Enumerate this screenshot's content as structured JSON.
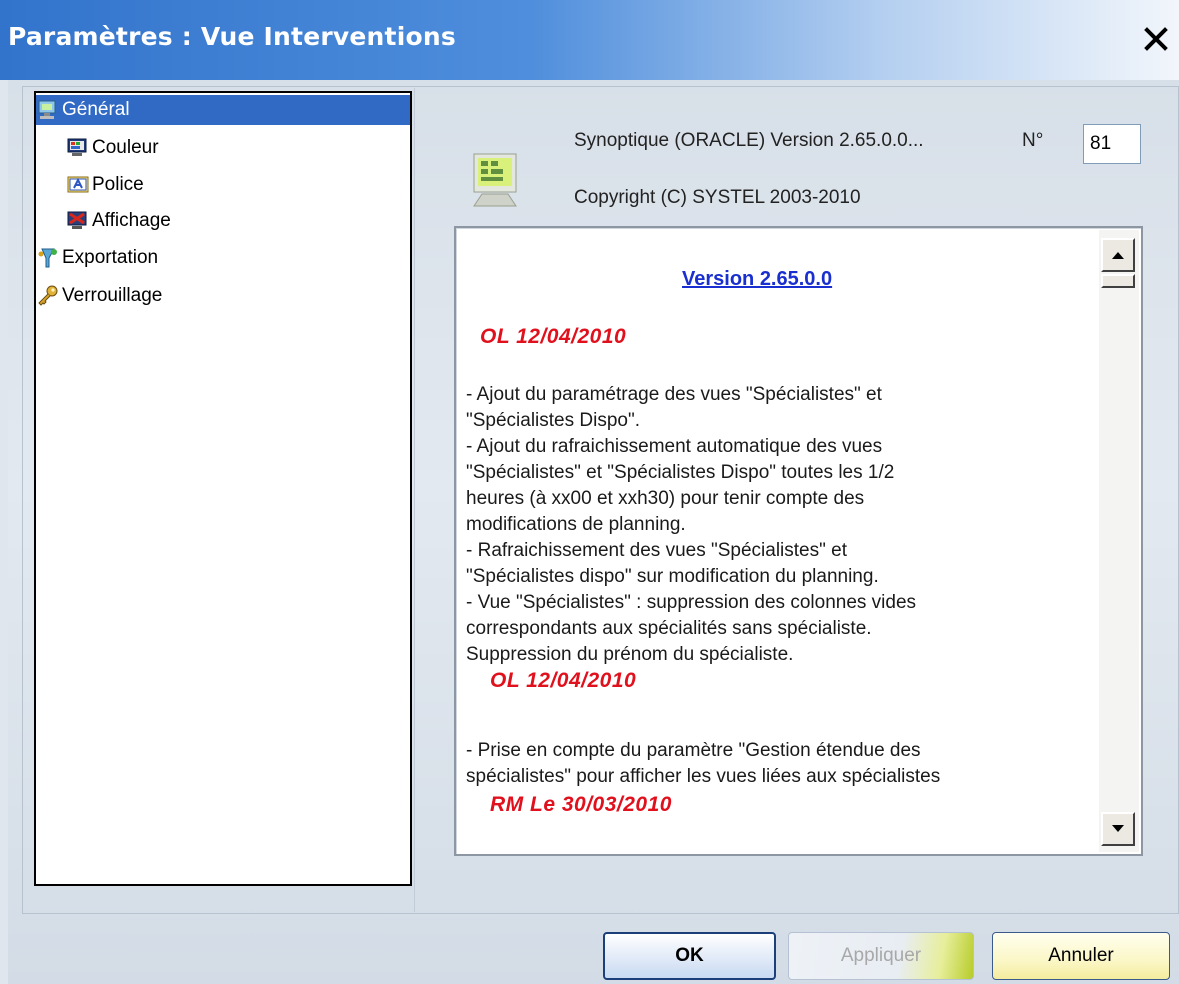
{
  "window": {
    "title": "Paramètres : Vue Interventions",
    "close_glyph": "✕"
  },
  "tree": {
    "items": [
      {
        "label": "Général",
        "icon": "general-settings-icon",
        "selected": true
      },
      {
        "label": "Couleur",
        "icon": "monitor-color-icon"
      },
      {
        "label": "Police",
        "icon": "font-icon"
      },
      {
        "label": "Affichage",
        "icon": "display-icon"
      },
      {
        "label": "Exportation",
        "icon": "export-icon"
      },
      {
        "label": "Verrouillage",
        "icon": "key-icon"
      }
    ]
  },
  "about": {
    "version_line": "Synoptique (ORACLE) Version 2.65.0.0...",
    "number_label": "N°",
    "number_value": "81",
    "copyright": "Copyright (C) SYSTEL 2003-2010"
  },
  "notes": {
    "heading": "Version 2.65.0.0",
    "author1": "OL 12/04/2010",
    "lines1": [
      "- Ajout du paramétrage des vues \"Spécialistes\" et",
      "\"Spécialistes Dispo\".",
      "- Ajout du rafraichissement automatique des vues",
      "\"Spécialistes\" et \"Spécialistes Dispo\" toutes les 1/2",
      "heures (à xx00 et xxh30) pour tenir compte des",
      "modifications de planning.",
      "- Rafraichissement des vues \"Spécialistes\" et",
      "\"Spécialistes dispo\" sur modification du planning.",
      "- Vue \"Spécialistes\" : suppression des colonnes vides",
      "correspondants aux spécialités sans spécialiste.",
      "Suppression du prénom du spécialiste."
    ],
    "author2": "OL 12/04/2010",
    "lines2": [
      "- Prise en compte du paramètre \"Gestion étendue des",
      "spécialistes\" pour afficher les vues liées aux spécialistes"
    ],
    "author3": "RM Le 30/03/2010"
  },
  "buttons": {
    "ok": "OK",
    "apply": "Appliquer",
    "cancel": "Annuler"
  },
  "colors": {
    "title_bar": "#3274cc",
    "selection": "#316ac5",
    "heading_link": "#1a2fcf",
    "author_red": "#e0101c"
  }
}
